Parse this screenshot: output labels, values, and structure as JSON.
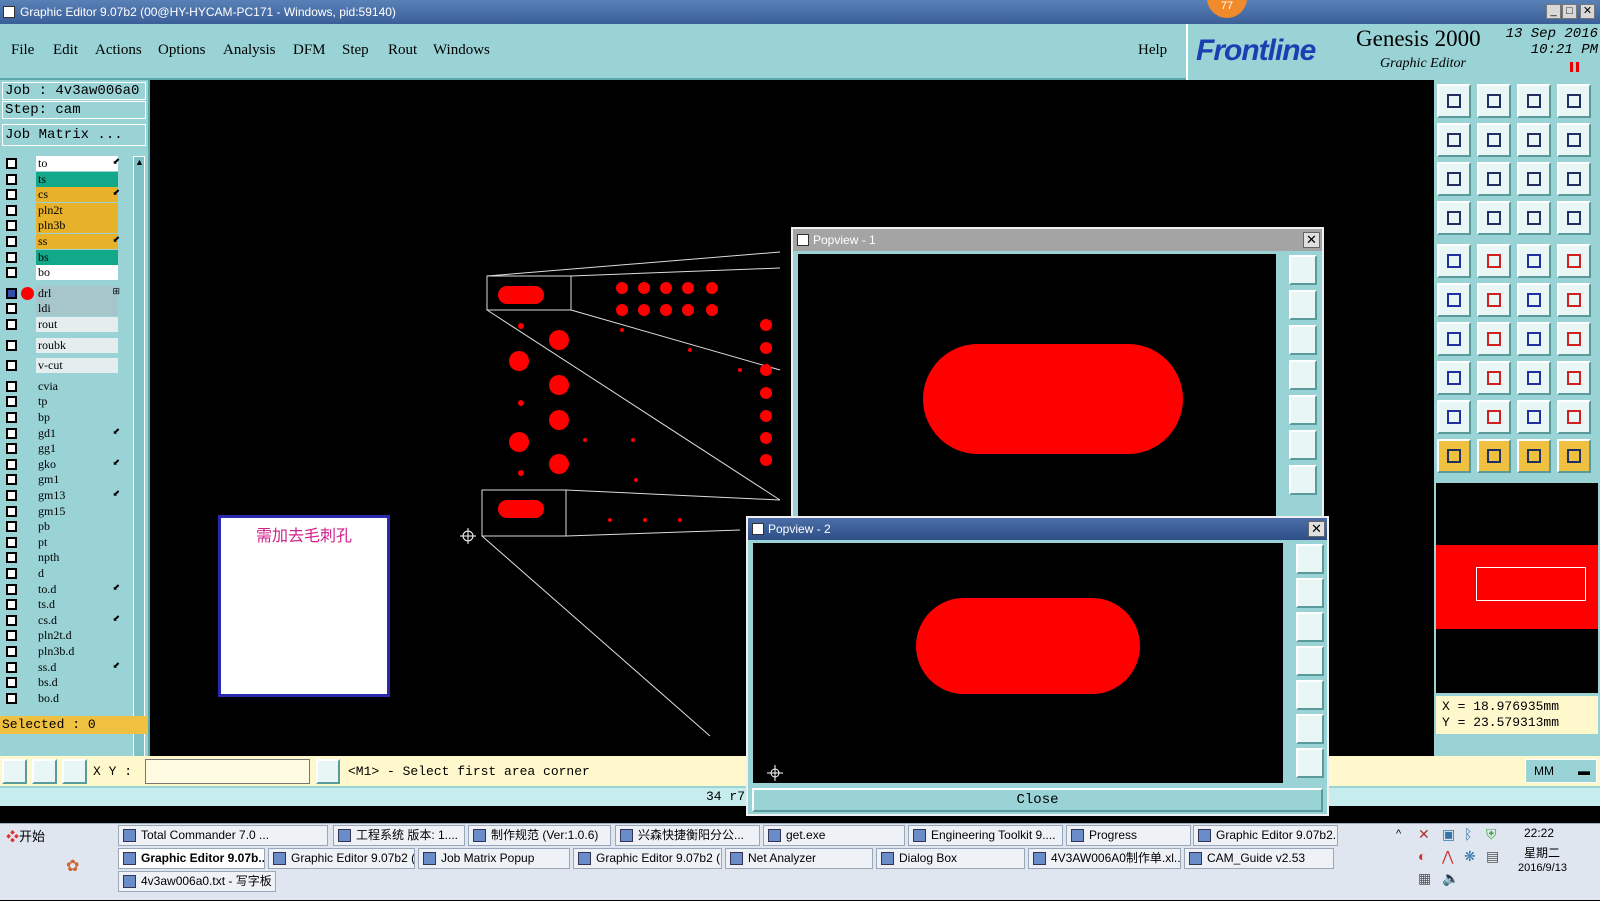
{
  "window": {
    "title": "Graphic Editor 9.07b2 (00@HY-HYCAM-PC171 - Windows, pid:59140)",
    "badge": "77"
  },
  "menu": {
    "items": [
      "File",
      "Edit",
      "Actions",
      "Options",
      "Analysis",
      "DFM",
      "Step",
      "Rout",
      "Windows"
    ],
    "help": "Help"
  },
  "brand": {
    "logo": "Frontline",
    "product": "Genesis 2000",
    "subtitle": "Graphic Editor",
    "date": "13 Sep 2016",
    "time": "10:21 PM"
  },
  "job": {
    "job_line": "Job : 4v3aw006a0",
    "step_line": "Step: cam",
    "matrix_button": "Job Matrix ..."
  },
  "layers": [
    {
      "name": "to",
      "color": "#ffffff",
      "flag": "⬋"
    },
    {
      "name": "ts",
      "color": "#12a88a",
      "flag": ""
    },
    {
      "name": "cs",
      "color": "#e8b12a",
      "flag": "⬋"
    },
    {
      "name": "pln2t",
      "color": "#e8b12a",
      "flag": ""
    },
    {
      "name": "pln3b",
      "color": "#e8b12a",
      "flag": ""
    },
    {
      "name": "ss",
      "color": "#e8b12a",
      "flag": "⬋"
    },
    {
      "name": "bs",
      "color": "#12a88a",
      "flag": ""
    },
    {
      "name": "bo",
      "color": "#ffffff",
      "flag": ""
    },
    {
      "name": "drl",
      "color": "#a6c6cc",
      "flag": "⊞"
    },
    {
      "name": "ldi",
      "color": "#a6c6cc",
      "flag": ""
    },
    {
      "name": "rout",
      "color": "#e4eeee",
      "flag": ""
    },
    {
      "name": "roubk",
      "color": "#e4eeee",
      "flag": ""
    },
    {
      "name": "v-cut",
      "color": "#e4eeee",
      "flag": ""
    },
    {
      "name": "cvia",
      "color": "#9ad3d6",
      "flag": ""
    },
    {
      "name": "tp",
      "color": "#9ad3d6",
      "flag": ""
    },
    {
      "name": "bp",
      "color": "#9ad3d6",
      "flag": ""
    },
    {
      "name": "gd1",
      "color": "#9ad3d6",
      "flag": "⬋"
    },
    {
      "name": "gg1",
      "color": "#9ad3d6",
      "flag": ""
    },
    {
      "name": "gko",
      "color": "#9ad3d6",
      "flag": "⬋"
    },
    {
      "name": "gm1",
      "color": "#9ad3d6",
      "flag": ""
    },
    {
      "name": "gm13",
      "color": "#9ad3d6",
      "flag": "⬋"
    },
    {
      "name": "gm15",
      "color": "#9ad3d6",
      "flag": ""
    },
    {
      "name": "pb",
      "color": "#9ad3d6",
      "flag": ""
    },
    {
      "name": "pt",
      "color": "#9ad3d6",
      "flag": ""
    },
    {
      "name": "npth",
      "color": "#9ad3d6",
      "flag": ""
    },
    {
      "name": "d",
      "color": "#9ad3d6",
      "flag": ""
    },
    {
      "name": "to.d",
      "color": "#9ad3d6",
      "flag": "⬋"
    },
    {
      "name": "ts.d",
      "color": "#9ad3d6",
      "flag": ""
    },
    {
      "name": "cs.d",
      "color": "#9ad3d6",
      "flag": "⬋"
    },
    {
      "name": "pln2t.d",
      "color": "#9ad3d6",
      "flag": ""
    },
    {
      "name": "pln3b.d",
      "color": "#9ad3d6",
      "flag": ""
    },
    {
      "name": "ss.d",
      "color": "#9ad3d6",
      "flag": "⬋"
    },
    {
      "name": "bs.d",
      "color": "#9ad3d6",
      "flag": ""
    },
    {
      "name": "bo.d",
      "color": "#9ad3d6",
      "flag": ""
    }
  ],
  "selected": "Selected : 0",
  "note": "需加去毛刺孔",
  "popview1": {
    "title": "Popview - 1"
  },
  "popview2": {
    "title": "Popview - 2",
    "close_label": "Close"
  },
  "coords": {
    "x": "X = 18.976935mm",
    "y": "Y = 23.579313mm"
  },
  "status": {
    "xy_label": "X Y :",
    "xy_value": "",
    "prompt": "<M1> - Select first area corner",
    "counter": "34 r7",
    "units": "MM"
  },
  "taskbar": {
    "start": "开始",
    "row1": [
      "Total Commander 7.0 ...",
      "工程系统  版本: 1....",
      "制作规范 (Ver:1.0.6)",
      "兴森快捷衡阳分公...",
      "get.exe",
      "Engineering Toolkit 9....",
      "Progress",
      "Graphic Editor 9.07b2..."
    ],
    "row2": [
      "Graphic Editor 9.07b...",
      "Graphic Editor 9.07b2 (...",
      "Job Matrix Popup",
      "Graphic Editor 9.07b2 (...",
      "Net Analyzer",
      "Dialog Box",
      "4V3AW006A0制作单.xl...",
      "CAM_Guide v2.53"
    ],
    "row3": [
      "4v3aw006a0.txt - 写字板"
    ],
    "clock": "22:22",
    "weekday": "星期二",
    "date": "2016/9/13"
  }
}
